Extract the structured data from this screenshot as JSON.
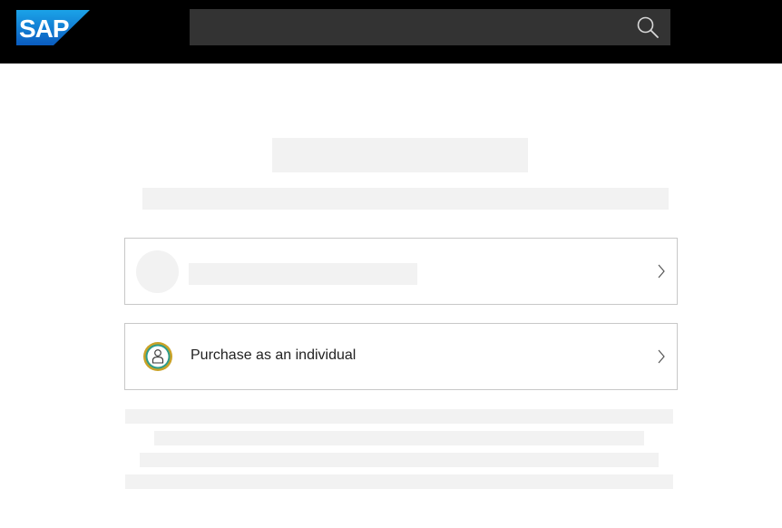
{
  "brand": {
    "logo_text": "SAP",
    "logo_color": "#1a6fd0"
  },
  "search": {
    "placeholder": "",
    "icon": "search-icon"
  },
  "options": [
    {
      "label": "",
      "loading": true,
      "icon": "placeholder-avatar"
    },
    {
      "label": "Purchase as an individual",
      "loading": false,
      "icon": "person-badge-icon"
    }
  ],
  "colors": {
    "header": "#000000",
    "search_bg": "#333333",
    "skeleton": "#f2f2f2",
    "badge_ring_outer": "#c9a227",
    "badge_ring_inner": "#2d9c8a"
  }
}
